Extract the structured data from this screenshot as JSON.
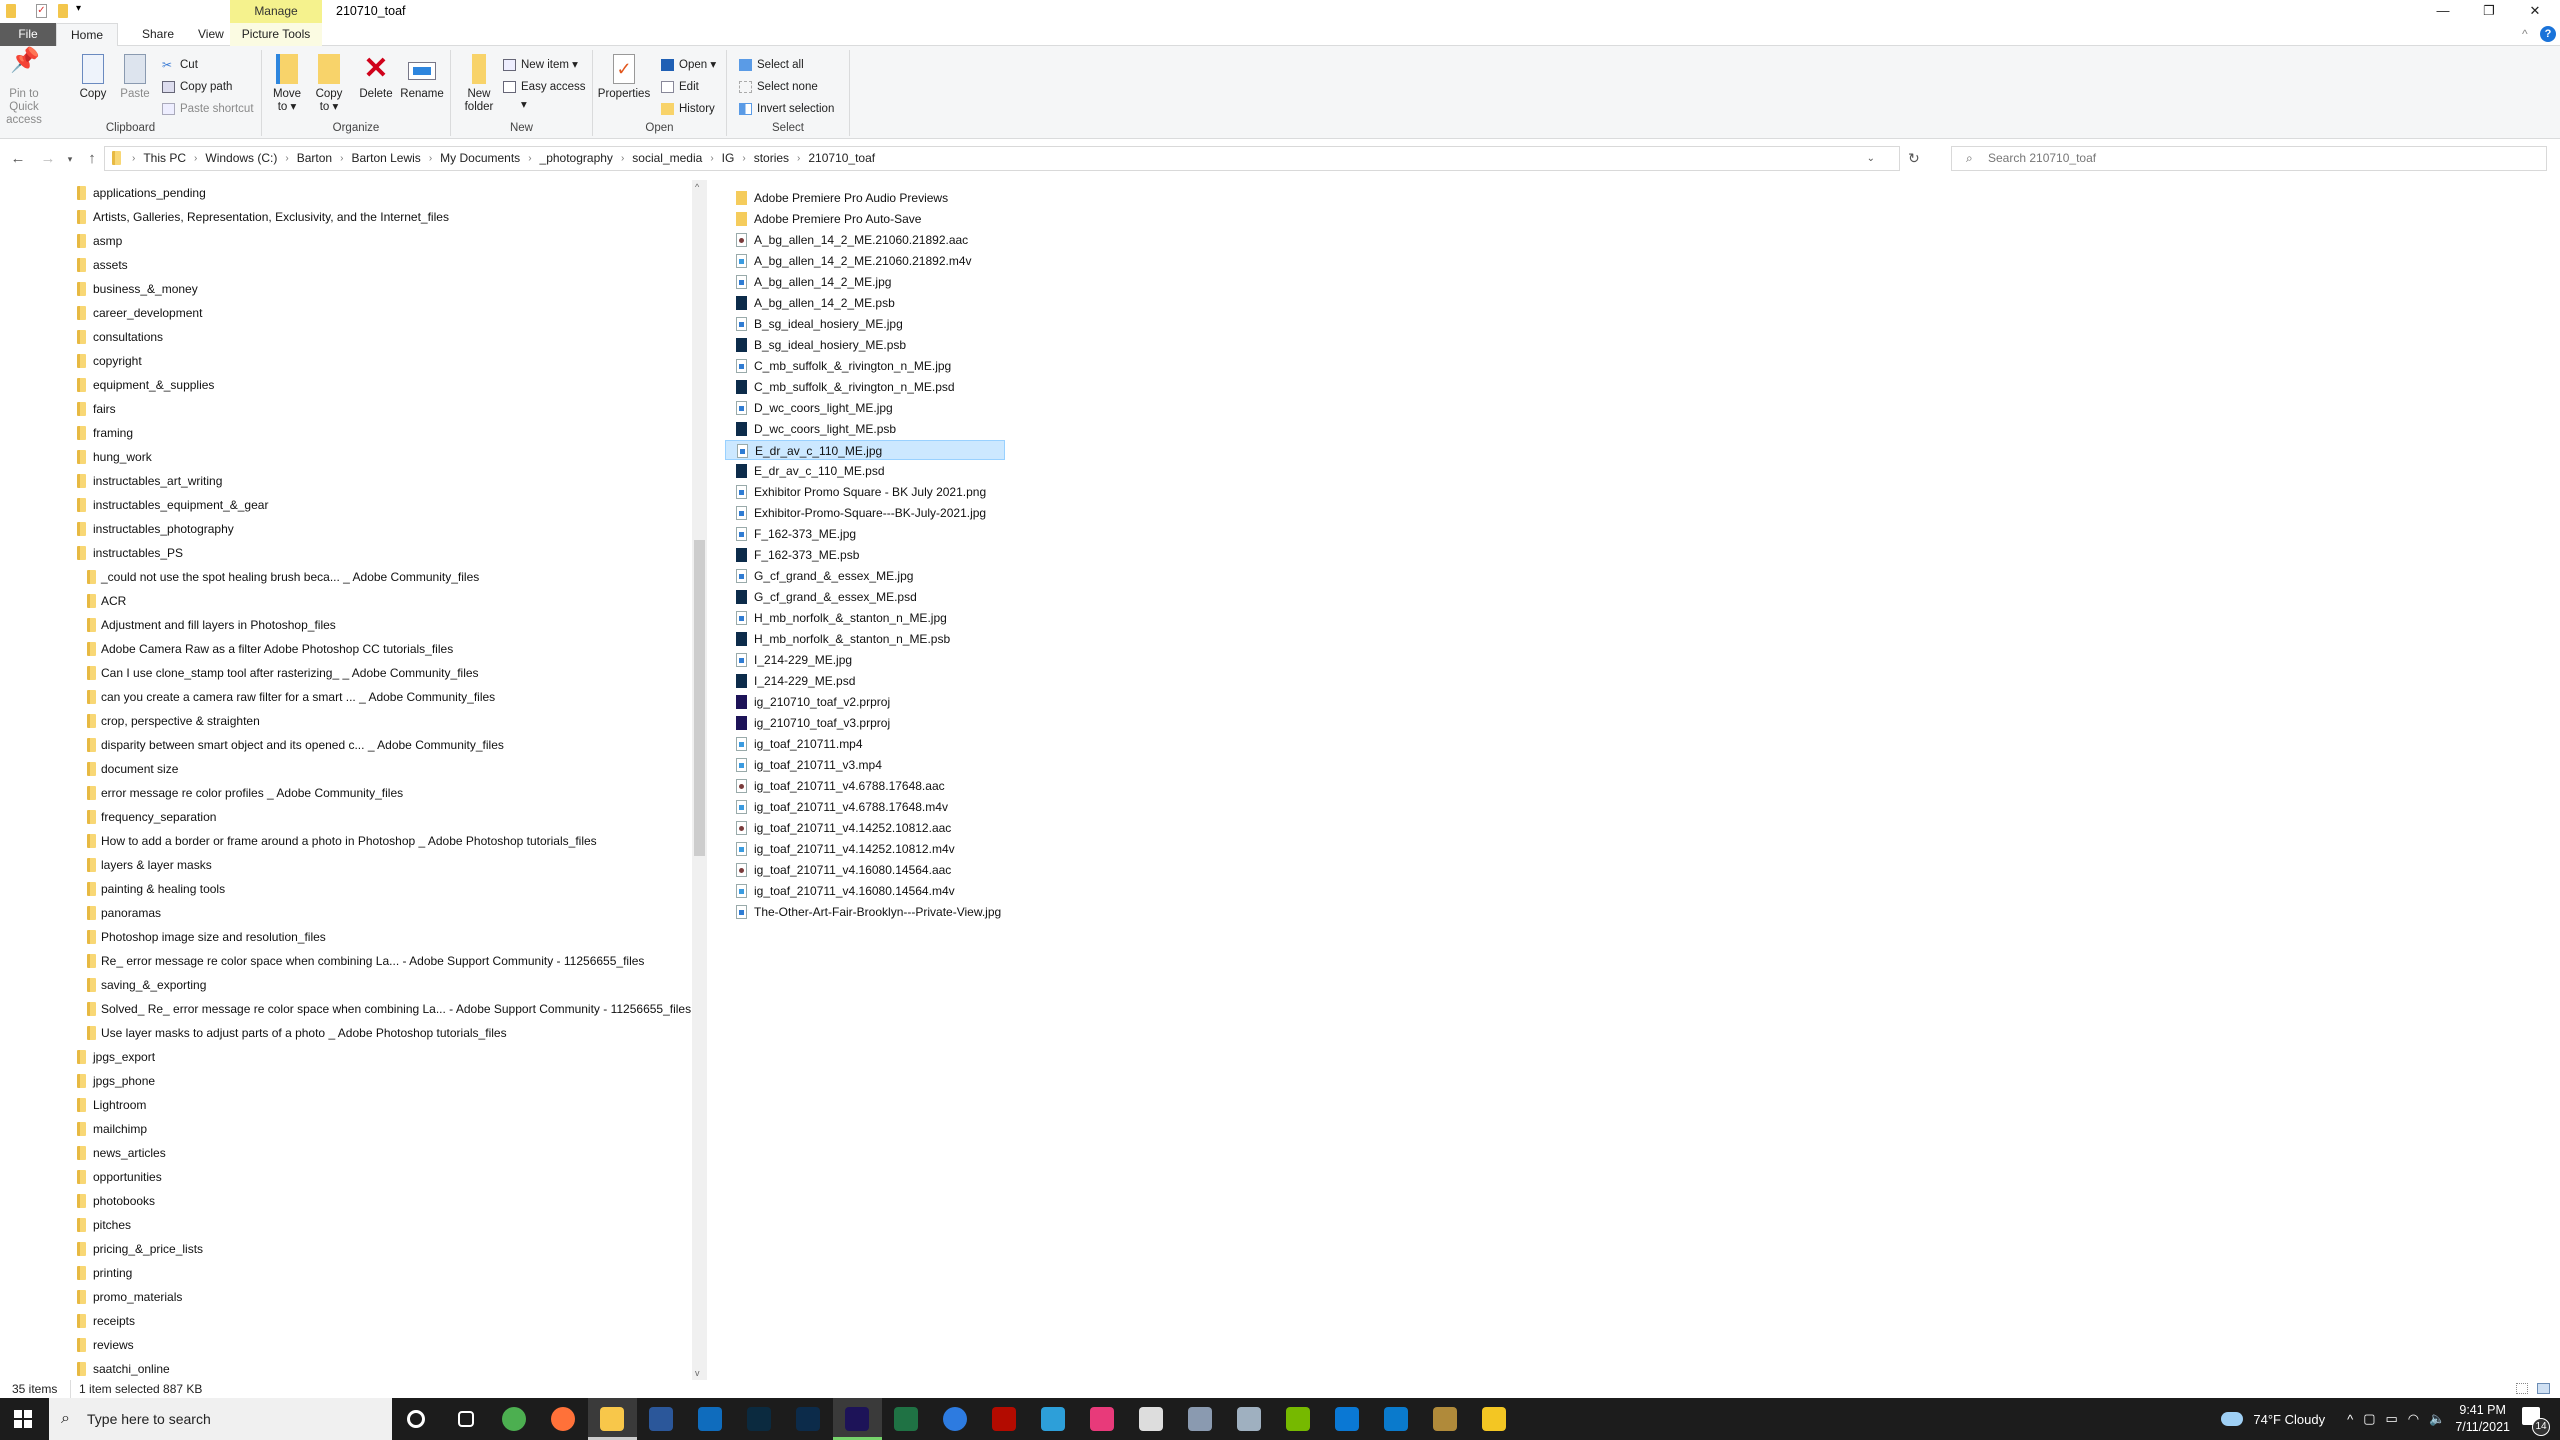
{
  "window": {
    "title": "210710_toaf",
    "context_tab": "Manage",
    "controls": [
      "—",
      "❐",
      "✕"
    ]
  },
  "tabs": {
    "file": "File",
    "home": "Home",
    "share": "Share",
    "view": "View",
    "picture_tools": "Picture Tools"
  },
  "ribbon": {
    "clipboard": {
      "label": "Clipboard",
      "pin": "Pin to Quick access",
      "copy": "Copy",
      "paste": "Paste",
      "cut": "Cut",
      "copy_path": "Copy path",
      "paste_shortcut": "Paste shortcut"
    },
    "organize": {
      "label": "Organize",
      "move_to": "Move to ▾",
      "copy_to": "Copy to ▾",
      "delete": "Delete",
      "rename": "Rename"
    },
    "new": {
      "label": "New",
      "new_folder": "New folder",
      "new_item": "New item ▾",
      "easy_access": "Easy access ▾"
    },
    "open": {
      "label": "Open",
      "properties": "Properties",
      "open": "Open ▾",
      "edit": "Edit",
      "history": "History"
    },
    "select": {
      "label": "Select",
      "select_all": "Select all",
      "select_none": "Select none",
      "invert": "Invert selection"
    }
  },
  "address": {
    "crumbs": [
      "This PC",
      "Windows (C:)",
      "Barton",
      "Barton Lewis",
      "My Documents",
      "_photography",
      "social_media",
      "IG",
      "stories",
      "210710_toaf"
    ],
    "search_placeholder": "Search 210710_toaf"
  },
  "nav_tree": [
    {
      "label": "applications_pending",
      "level": 1
    },
    {
      "label": "Artists, Galleries, Representation, Exclusivity, and the Internet_files",
      "level": 1
    },
    {
      "label": "asmp",
      "level": 1
    },
    {
      "label": "assets",
      "level": 1
    },
    {
      "label": "business_&_money",
      "level": 1
    },
    {
      "label": "career_development",
      "level": 1
    },
    {
      "label": "consultations",
      "level": 1
    },
    {
      "label": "copyright",
      "level": 1
    },
    {
      "label": "equipment_&_supplies",
      "level": 1
    },
    {
      "label": "fairs",
      "level": 1
    },
    {
      "label": "framing",
      "level": 1
    },
    {
      "label": "hung_work",
      "level": 1
    },
    {
      "label": "instructables_art_writing",
      "level": 1
    },
    {
      "label": "instructables_equipment_&_gear",
      "level": 1
    },
    {
      "label": "instructables_photography",
      "level": 1
    },
    {
      "label": "instructables_PS",
      "level": 1
    },
    {
      "label": "_could not use the spot healing brush beca... _ Adobe Community_files",
      "level": 2
    },
    {
      "label": "ACR",
      "level": 2
    },
    {
      "label": "Adjustment and fill layers in Photoshop_files",
      "level": 2
    },
    {
      "label": "Adobe Camera Raw as a filter   Adobe Photoshop CC tutorials_files",
      "level": 2
    },
    {
      "label": "Can I use clone_stamp tool after rasterizing_ _ Adobe Community_files",
      "level": 2
    },
    {
      "label": "can you create a camera raw filter for a smart ... _ Adobe Community_files",
      "level": 2
    },
    {
      "label": "crop, perspective & straighten",
      "level": 2
    },
    {
      "label": "disparity between smart object and its opened c... _ Adobe Community_files",
      "level": 2
    },
    {
      "label": "document size",
      "level": 2
    },
    {
      "label": "error message re color profiles _ Adobe Community_files",
      "level": 2
    },
    {
      "label": "frequency_separation",
      "level": 2
    },
    {
      "label": "How to add a border or frame around a photo in Photoshop _ Adobe Photoshop tutorials_files",
      "level": 2
    },
    {
      "label": "layers & layer masks",
      "level": 2
    },
    {
      "label": "painting & healing tools",
      "level": 2
    },
    {
      "label": "panoramas",
      "level": 2
    },
    {
      "label": "Photoshop image size and resolution_files",
      "level": 2
    },
    {
      "label": "Re_ error message re color space when combining La... - Adobe Support Community - 11256655_files",
      "level": 2
    },
    {
      "label": "saving_&_exporting",
      "level": 2
    },
    {
      "label": "Solved_ Re_ error message re color space when combining La... - Adobe Support Community - 11256655_files",
      "level": 2
    },
    {
      "label": "Use layer masks to adjust parts of a photo _ Adobe Photoshop tutorials_files",
      "level": 2
    },
    {
      "label": "jpgs_export",
      "level": 1
    },
    {
      "label": "jpgs_phone",
      "level": 1
    },
    {
      "label": "Lightroom",
      "level": 1
    },
    {
      "label": "mailchimp",
      "level": 1
    },
    {
      "label": "news_articles",
      "level": 1
    },
    {
      "label": "opportunities",
      "level": 1
    },
    {
      "label": "photobooks",
      "level": 1
    },
    {
      "label": "pitches",
      "level": 1
    },
    {
      "label": "pricing_&_price_lists",
      "level": 1
    },
    {
      "label": "printing",
      "level": 1
    },
    {
      "label": "promo_materials",
      "level": 1
    },
    {
      "label": "receipts",
      "level": 1
    },
    {
      "label": "reviews",
      "level": 1
    },
    {
      "label": "saatchi_online",
      "level": 1
    }
  ],
  "files": [
    {
      "name": "Adobe Premiere Pro Audio Previews",
      "type": "folder"
    },
    {
      "name": "Adobe Premiere Pro Auto-Save",
      "type": "folder"
    },
    {
      "name": "A_bg_allen_14_2_ME.21060.21892.aac",
      "type": "aud"
    },
    {
      "name": "A_bg_allen_14_2_ME.21060.21892.m4v",
      "type": "vid"
    },
    {
      "name": "A_bg_allen_14_2_ME.jpg",
      "type": "img"
    },
    {
      "name": "A_bg_allen_14_2_ME.psb",
      "type": "ps"
    },
    {
      "name": "B_sg_ideal_hosiery_ME.jpg",
      "type": "img"
    },
    {
      "name": "B_sg_ideal_hosiery_ME.psb",
      "type": "ps"
    },
    {
      "name": "C_mb_suffolk_&_rivington_n_ME.jpg",
      "type": "img"
    },
    {
      "name": "C_mb_suffolk_&_rivington_n_ME.psd",
      "type": "ps"
    },
    {
      "name": "D_wc_coors_light_ME.jpg",
      "type": "img"
    },
    {
      "name": "D_wc_coors_light_ME.psb",
      "type": "ps"
    },
    {
      "name": "E_dr_av_c_110_ME.jpg",
      "type": "img",
      "selected": true
    },
    {
      "name": "E_dr_av_c_110_ME.psd",
      "type": "ps"
    },
    {
      "name": "Exhibitor Promo Square - BK July 2021.png",
      "type": "img"
    },
    {
      "name": "Exhibitor-Promo-Square---BK-July-2021.jpg",
      "type": "img"
    },
    {
      "name": "F_162-373_ME.jpg",
      "type": "img"
    },
    {
      "name": "F_162-373_ME.psb",
      "type": "ps"
    },
    {
      "name": "G_cf_grand_&_essex_ME.jpg",
      "type": "img"
    },
    {
      "name": "G_cf_grand_&_essex_ME.psd",
      "type": "ps"
    },
    {
      "name": "H_mb_norfolk_&_stanton_n_ME.jpg",
      "type": "img"
    },
    {
      "name": "H_mb_norfolk_&_stanton_n_ME.psb",
      "type": "ps"
    },
    {
      "name": "I_214-229_ME.jpg",
      "type": "img"
    },
    {
      "name": "I_214-229_ME.psd",
      "type": "ps"
    },
    {
      "name": "ig_210710_toaf_v2.prproj",
      "type": "pr"
    },
    {
      "name": "ig_210710_toaf_v3.prproj",
      "type": "pr"
    },
    {
      "name": "ig_toaf_210711.mp4",
      "type": "vid"
    },
    {
      "name": "ig_toaf_210711_v3.mp4",
      "type": "vid"
    },
    {
      "name": "ig_toaf_210711_v4.6788.17648.aac",
      "type": "aud"
    },
    {
      "name": "ig_toaf_210711_v4.6788.17648.m4v",
      "type": "vid"
    },
    {
      "name": "ig_toaf_210711_v4.14252.10812.aac",
      "type": "aud"
    },
    {
      "name": "ig_toaf_210711_v4.14252.10812.m4v",
      "type": "vid"
    },
    {
      "name": "ig_toaf_210711_v4.16080.14564.aac",
      "type": "aud"
    },
    {
      "name": "ig_toaf_210711_v4.16080.14564.m4v",
      "type": "vid"
    },
    {
      "name": "The-Other-Art-Fair-Brooklyn---Private-View.jpg",
      "type": "img"
    }
  ],
  "status": {
    "count": "35 items",
    "selection": "1 item selected  887 KB"
  },
  "taskbar": {
    "search_placeholder": "Type here to search",
    "apps": [
      {
        "name": "cortana",
        "color": "#1c1c1c"
      },
      {
        "name": "task-view",
        "color": "#1c1c1c"
      },
      {
        "name": "chrome",
        "color": "#4caf50"
      },
      {
        "name": "firefox",
        "color": "#ff7139"
      },
      {
        "name": "file-explorer",
        "color": "#f8c74a"
      },
      {
        "name": "word",
        "color": "#2b579a"
      },
      {
        "name": "outlook",
        "color": "#0f6cbd"
      },
      {
        "name": "lightroom-classic",
        "color": "#0b2a3f"
      },
      {
        "name": "photoshop",
        "color": "#0c2b4a"
      },
      {
        "name": "premiere-pro",
        "color": "#1d1358"
      },
      {
        "name": "excel",
        "color": "#1f7244"
      },
      {
        "name": "app-i",
        "color": "#2d7be0"
      },
      {
        "name": "acrobat",
        "color": "#b30b00"
      },
      {
        "name": "brackets",
        "color": "#2d9fd9"
      },
      {
        "name": "creative-cloud",
        "color": "#e83a7a"
      },
      {
        "name": "nec-display",
        "color": "#dddddd"
      },
      {
        "name": "app-script",
        "color": "#8a9ab0"
      },
      {
        "name": "calculator",
        "color": "#9fb0c0"
      },
      {
        "name": "nvidia",
        "color": "#76b900"
      },
      {
        "name": "time-machine",
        "color": "#0a78d4"
      },
      {
        "name": "vscode",
        "color": "#0a7acc"
      },
      {
        "name": "app-pina-colada",
        "color": "#b08a3a"
      },
      {
        "name": "rubber-duck",
        "color": "#f3c623"
      }
    ],
    "weather": "74°F  Cloudy",
    "time": "9:41 PM",
    "date": "7/11/2021",
    "notifications": "14"
  }
}
